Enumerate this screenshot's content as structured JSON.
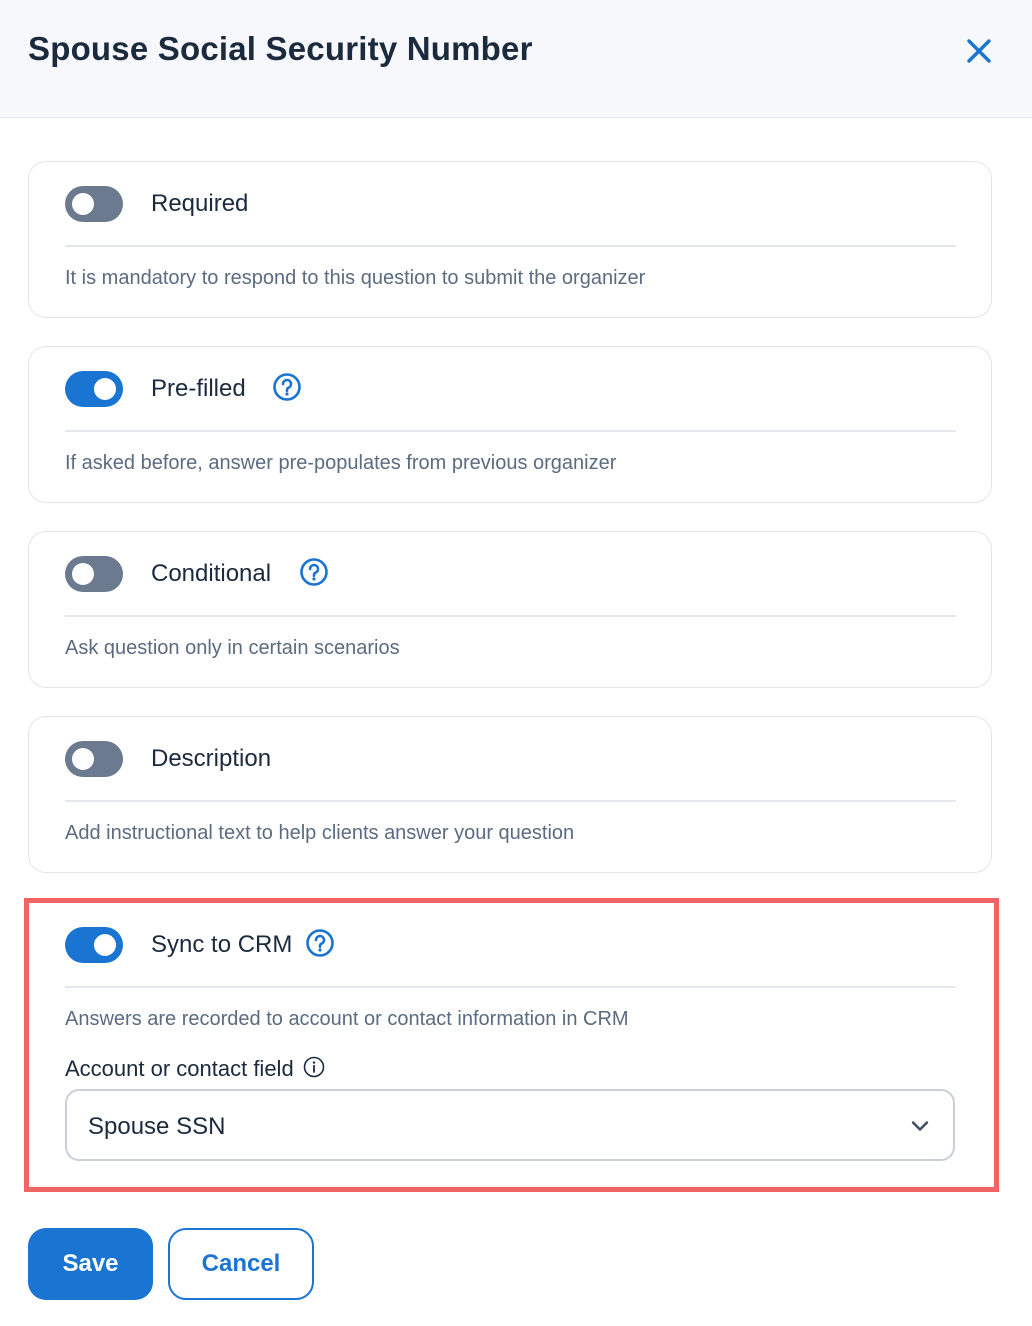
{
  "dialog": {
    "title": "Spouse Social Security Number"
  },
  "options": [
    {
      "label": "Required",
      "enabled": false,
      "has_help": false,
      "description": "It is mandatory to respond to this question to submit the organizer"
    },
    {
      "label": "Pre-filled",
      "enabled": true,
      "has_help": true,
      "description": "If asked before, answer pre-populates from previous organizer"
    },
    {
      "label": "Conditional",
      "enabled": false,
      "has_help": true,
      "description": "Ask question only in certain scenarios"
    },
    {
      "label": "Description",
      "enabled": false,
      "has_help": false,
      "description": "Add instructional text to help clients answer your question"
    },
    {
      "label": "Sync to CRM",
      "enabled": true,
      "has_help": true,
      "description": "Answers are recorded to account or contact information in CRM",
      "field_label": "Account or contact field",
      "field_value": "Spouse SSN"
    }
  ],
  "actions": {
    "save_label": "Save",
    "cancel_label": "Cancel"
  },
  "colors": {
    "accent": "#1a74d2",
    "toggle_off": "#6c7a90",
    "highlight_border": "#f26464"
  },
  "icons": {
    "close": "close-icon",
    "help": "question-circle-icon",
    "info": "info-circle-icon",
    "dropdown": "chevron-down-icon"
  }
}
